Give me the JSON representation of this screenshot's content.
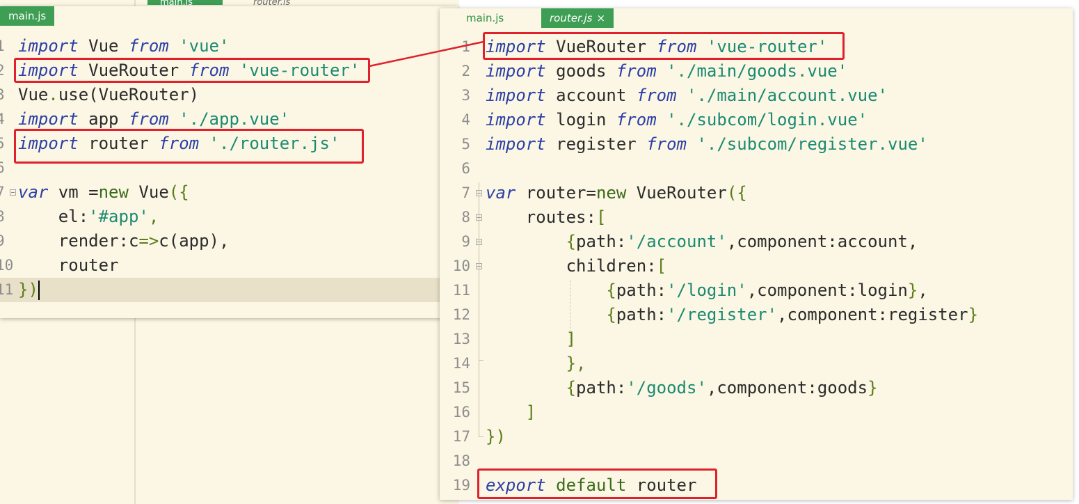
{
  "background": {
    "tabs": [
      "main.js",
      "router.js"
    ]
  },
  "main_window": {
    "tab_label": "main.js",
    "lines": [
      {
        "n": "1",
        "tokens": [
          [
            "kw",
            "import"
          ],
          [
            "prp",
            " Vue "
          ],
          [
            "kw",
            "from"
          ],
          [
            "prp",
            " "
          ],
          [
            "str",
            "'vue'"
          ]
        ]
      },
      {
        "n": "2",
        "tokens": [
          [
            "kw",
            "import"
          ],
          [
            "prp",
            " VueRouter "
          ],
          [
            "kw",
            "from"
          ],
          [
            "prp",
            " "
          ],
          [
            "str",
            "'vue-router'"
          ]
        ]
      },
      {
        "n": "3",
        "tokens": [
          [
            "prp",
            "Vue"
          ],
          [
            "pun",
            "."
          ],
          [
            "prp",
            "use(VueRouter)"
          ]
        ]
      },
      {
        "n": "4",
        "tokens": [
          [
            "kw",
            "import"
          ],
          [
            "prp",
            " app "
          ],
          [
            "kw",
            "from"
          ],
          [
            "prp",
            " "
          ],
          [
            "str",
            "'./app.vue'"
          ]
        ]
      },
      {
        "n": "5",
        "tokens": [
          [
            "kw",
            "import"
          ],
          [
            "prp",
            " router "
          ],
          [
            "kw",
            "from"
          ],
          [
            "prp",
            " "
          ],
          [
            "str",
            "'./router.js'"
          ]
        ]
      },
      {
        "n": "6",
        "tokens": []
      },
      {
        "n": "7",
        "tokens": [
          [
            "kw",
            "var"
          ],
          [
            "prp",
            " vm ="
          ],
          [
            "kw2",
            "new"
          ],
          [
            "prp",
            " Vue"
          ],
          [
            "pun",
            "({"
          ]
        ]
      },
      {
        "n": "8",
        "tokens": [
          [
            "prp",
            "    el:"
          ],
          [
            "str",
            "'#app'"
          ],
          [
            "pun",
            ","
          ]
        ]
      },
      {
        "n": "9",
        "tokens": [
          [
            "prp",
            "    render:c"
          ],
          [
            "pun",
            "=>"
          ],
          [
            "prp",
            "c(app),"
          ]
        ]
      },
      {
        "n": "10",
        "tokens": [
          [
            "prp",
            "    router"
          ]
        ]
      },
      {
        "n": "11",
        "tokens": [
          [
            "pun",
            "})"
          ]
        ]
      }
    ]
  },
  "router_window": {
    "tab_inactive": "main.js",
    "tab_active": "router.js",
    "close_glyph": "×",
    "lines": [
      {
        "n": "1",
        "tokens": [
          [
            "kw",
            "import"
          ],
          [
            "prp",
            " VueRouter "
          ],
          [
            "kw",
            "from"
          ],
          [
            "prp",
            " "
          ],
          [
            "str",
            "'vue-router'"
          ]
        ]
      },
      {
        "n": "2",
        "tokens": [
          [
            "kw",
            "import"
          ],
          [
            "prp",
            " goods "
          ],
          [
            "kw",
            "from"
          ],
          [
            "prp",
            " "
          ],
          [
            "str",
            "'./main/goods.vue'"
          ]
        ]
      },
      {
        "n": "3",
        "tokens": [
          [
            "kw",
            "import"
          ],
          [
            "prp",
            " account "
          ],
          [
            "kw",
            "from"
          ],
          [
            "prp",
            " "
          ],
          [
            "str",
            "'./main/account.vue'"
          ]
        ]
      },
      {
        "n": "4",
        "tokens": [
          [
            "kw",
            "import"
          ],
          [
            "prp",
            " login "
          ],
          [
            "kw",
            "from"
          ],
          [
            "prp",
            " "
          ],
          [
            "str",
            "'./subcom/login.vue'"
          ]
        ]
      },
      {
        "n": "5",
        "tokens": [
          [
            "kw",
            "import"
          ],
          [
            "prp",
            " register "
          ],
          [
            "kw",
            "from"
          ],
          [
            "prp",
            " "
          ],
          [
            "str",
            "'./subcom/register.vue'"
          ]
        ]
      },
      {
        "n": "6",
        "tokens": []
      },
      {
        "n": "7",
        "tokens": [
          [
            "kw",
            "var"
          ],
          [
            "prp",
            " router="
          ],
          [
            "kw2",
            "new"
          ],
          [
            "prp",
            " VueRouter"
          ],
          [
            "pun",
            "({"
          ]
        ]
      },
      {
        "n": "8",
        "tokens": [
          [
            "prp",
            "    routes:"
          ],
          [
            "pun",
            "["
          ]
        ]
      },
      {
        "n": "9",
        "tokens": [
          [
            "prp",
            "        "
          ],
          [
            "pun",
            "{"
          ],
          [
            "prp",
            "path:"
          ],
          [
            "str",
            "'/account'"
          ],
          [
            "prp",
            ",component:account,"
          ]
        ]
      },
      {
        "n": "10",
        "tokens": [
          [
            "prp",
            "        children:"
          ],
          [
            "pun",
            "["
          ]
        ]
      },
      {
        "n": "11",
        "tokens": [
          [
            "prp",
            "            "
          ],
          [
            "pun",
            "{"
          ],
          [
            "prp",
            "path:"
          ],
          [
            "str",
            "'/login'"
          ],
          [
            "prp",
            ",component:login"
          ],
          [
            "pun",
            "}"
          ],
          [
            "prp",
            ","
          ]
        ]
      },
      {
        "n": "12",
        "tokens": [
          [
            "prp",
            "            "
          ],
          [
            "pun",
            "{"
          ],
          [
            "prp",
            "path:"
          ],
          [
            "str",
            "'/register'"
          ],
          [
            "prp",
            ",component:register"
          ],
          [
            "pun",
            "}"
          ]
        ]
      },
      {
        "n": "13",
        "tokens": [
          [
            "prp",
            "        "
          ],
          [
            "pun",
            "]"
          ]
        ]
      },
      {
        "n": "14",
        "tokens": [
          [
            "prp",
            "        "
          ],
          [
            "pun",
            "},"
          ]
        ]
      },
      {
        "n": "15",
        "tokens": [
          [
            "prp",
            "        "
          ],
          [
            "pun",
            "{"
          ],
          [
            "prp",
            "path:"
          ],
          [
            "str",
            "'/goods'"
          ],
          [
            "prp",
            ",component:goods"
          ],
          [
            "pun",
            "}"
          ]
        ]
      },
      {
        "n": "16",
        "tokens": [
          [
            "prp",
            "    "
          ],
          [
            "pun",
            "]"
          ]
        ]
      },
      {
        "n": "17",
        "tokens": [
          [
            "pun",
            "})"
          ]
        ]
      },
      {
        "n": "18",
        "tokens": []
      },
      {
        "n": "19",
        "tokens": [
          [
            "kw",
            "export"
          ],
          [
            "prp",
            " "
          ],
          [
            "kw2",
            "default"
          ],
          [
            "prp",
            " router"
          ]
        ]
      }
    ]
  },
  "colors": {
    "highlight_box": "#e0212c",
    "tab_active": "#3e9e53",
    "editor_bg": "#fbf7e4"
  }
}
